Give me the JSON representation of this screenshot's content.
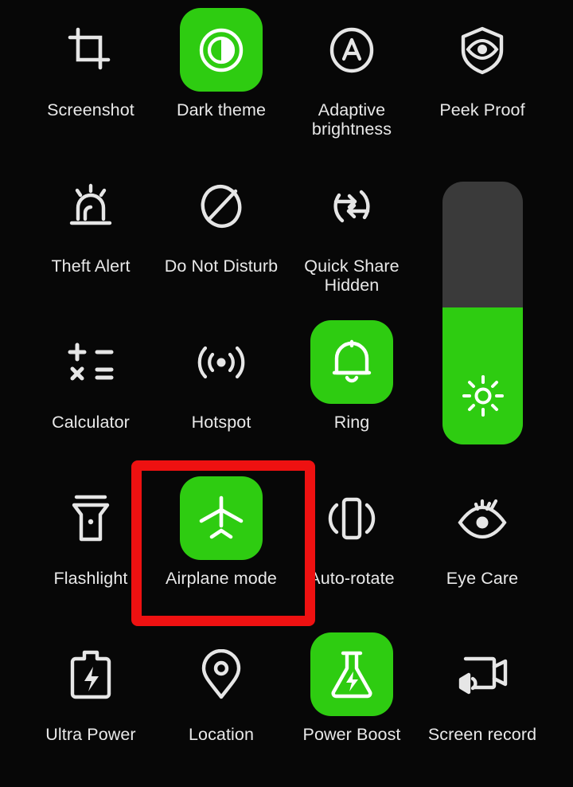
{
  "panel": {
    "name": "Quick settings panel",
    "background_color": "#070707",
    "accent_color": "#2ECC11",
    "label_color": "#FFFFFF",
    "highlight_color": "#EE1111"
  },
  "rows": [
    {
      "tiles": [
        {
          "label": "Screenshot",
          "icon": "crop-icon",
          "state": "off"
        },
        {
          "label": "Dark theme",
          "icon": "contrast-circle-icon",
          "state": "on"
        },
        {
          "label": "Adaptive\nbrightness",
          "icon": "letter-a-circle-icon",
          "state": "off"
        },
        {
          "label": "Peek Proof",
          "icon": "shield-eye-icon",
          "state": "off"
        }
      ]
    },
    {
      "tiles": [
        {
          "label": "Theft Alert",
          "icon": "siren-icon",
          "state": "off"
        },
        {
          "label": "Do Not Disturb",
          "icon": "circle-slash-icon",
          "state": "off"
        },
        {
          "label": "Quick Share\nHidden",
          "icon": "share-circle-arrows-icon",
          "state": "off"
        }
      ]
    },
    {
      "tiles": [
        {
          "label": "Calculator",
          "icon": "calculator-symbols-icon",
          "state": "off"
        },
        {
          "label": "Hotspot",
          "icon": "hotspot-waves-icon",
          "state": "off"
        },
        {
          "label": "Ring",
          "icon": "bell-icon",
          "state": "on"
        }
      ]
    },
    {
      "tiles": [
        {
          "label": "Flashlight",
          "icon": "flashlight-icon",
          "state": "off"
        },
        {
          "label": "Airplane mode",
          "icon": "airplane-icon",
          "state": "on"
        },
        {
          "label": "Auto-rotate",
          "icon": "phone-rotate-icon",
          "state": "off"
        },
        {
          "label": "Eye Care",
          "icon": "eye-lashes-icon",
          "state": "off"
        }
      ]
    },
    {
      "tiles": [
        {
          "label": "Ultra Power",
          "icon": "battery-bolt-icon",
          "state": "off"
        },
        {
          "label": "Location",
          "icon": "map-pin-icon",
          "state": "off"
        },
        {
          "label": "Power Boost",
          "icon": "flask-bolt-icon",
          "state": "on"
        },
        {
          "label": "Screen record",
          "icon": "video-camera-icon",
          "state": "off"
        }
      ]
    }
  ],
  "brightness_slider": {
    "name": "Brightness slider",
    "icon": "brightness-sun-icon",
    "fill_percent": 52,
    "track_color": "#3A3A3A",
    "fill_color": "#2ECC11"
  },
  "highlight": {
    "name": "Red highlight box around Airplane mode tile",
    "target_label": "Airplane mode",
    "color": "#EE1111"
  }
}
